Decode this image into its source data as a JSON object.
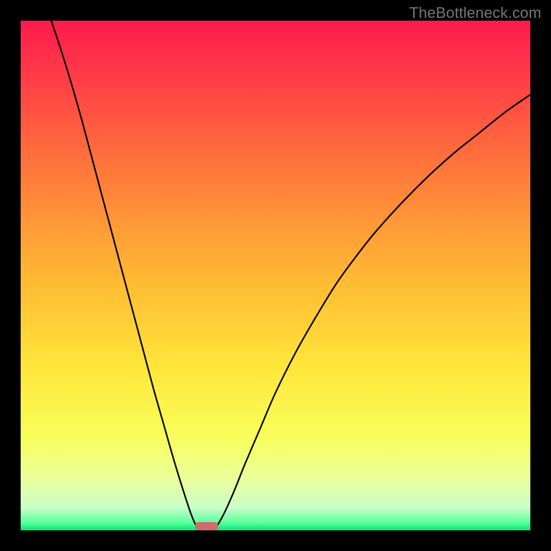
{
  "watermark": "TheBottleneck.com",
  "chart_data": {
    "type": "line",
    "title": "",
    "xlabel": "",
    "ylabel": "",
    "xlim": [
      0,
      100
    ],
    "ylim": [
      0,
      100
    ],
    "gradient_stops": [
      {
        "offset": 0.0,
        "color": "#ff1a4d"
      },
      {
        "offset": 0.12,
        "color": "#ff3f46"
      },
      {
        "offset": 0.3,
        "color": "#ff7a3a"
      },
      {
        "offset": 0.5,
        "color": "#ffb733"
      },
      {
        "offset": 0.68,
        "color": "#ffe63a"
      },
      {
        "offset": 0.82,
        "color": "#f8ff5c"
      },
      {
        "offset": 0.9,
        "color": "#eaff9c"
      },
      {
        "offset": 0.955,
        "color": "#c9ffc9"
      },
      {
        "offset": 0.985,
        "color": "#5cff9e"
      },
      {
        "offset": 1.0,
        "color": "#00e873"
      }
    ],
    "series": [
      {
        "name": "left-branch",
        "x": [
          6,
          8,
          10,
          12,
          14,
          16,
          18,
          20,
          22,
          24,
          26,
          28,
          30,
          32,
          33.5,
          34.5,
          35.2
        ],
        "y": [
          100,
          94,
          87.5,
          80.5,
          73,
          65.5,
          58,
          50.5,
          43,
          35.5,
          28,
          21,
          14,
          7.5,
          3,
          0.8,
          0.0
        ]
      },
      {
        "name": "right-branch",
        "x": [
          37.8,
          38.5,
          40,
          42,
          44,
          47,
          50,
          54,
          58,
          62,
          66,
          70,
          75,
          80,
          85,
          90,
          95,
          100
        ],
        "y": [
          0.0,
          0.8,
          3.5,
          8,
          13,
          20,
          27,
          35,
          42,
          48.5,
          54,
          59,
          64.5,
          69.5,
          74,
          78,
          82,
          85.5
        ]
      }
    ],
    "marker": {
      "name": "minimum-marker",
      "x_center": 36.5,
      "width_pct": 4.5,
      "y_bottom": 0,
      "height_pct": 1.6,
      "color": "#cf6b6b"
    }
  }
}
